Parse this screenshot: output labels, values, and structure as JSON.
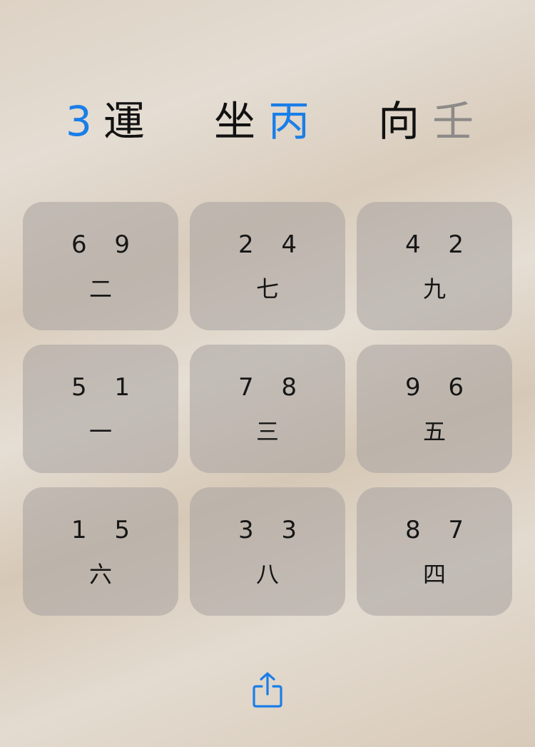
{
  "header": {
    "period_number": "3",
    "period_label": "運",
    "sitting_label": "坐",
    "sitting_value": "丙",
    "facing_label": "向",
    "facing_value": "壬"
  },
  "grid": [
    {
      "stars": "6 9",
      "base": "二"
    },
    {
      "stars": "2 4",
      "base": "七"
    },
    {
      "stars": "4 2",
      "base": "九"
    },
    {
      "stars": "5 1",
      "base": "一"
    },
    {
      "stars": "7 8",
      "base": "三"
    },
    {
      "stars": "9 6",
      "base": "五"
    },
    {
      "stars": "1 5",
      "base": "六"
    },
    {
      "stars": "3 3",
      "base": "八"
    },
    {
      "stars": "8 7",
      "base": "四"
    }
  ],
  "toolbar": {
    "share_icon": "share-icon"
  },
  "colors": {
    "accent": "#1a7ee8",
    "text": "#111111",
    "muted": "#8d8a88",
    "tile": "#a8a2a0"
  }
}
